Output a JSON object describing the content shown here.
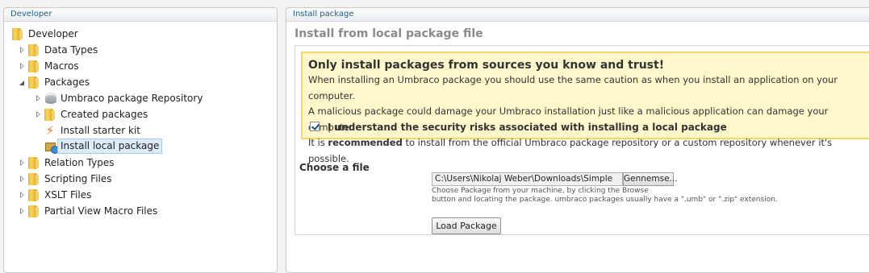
{
  "left_panel": {
    "header": "Developer",
    "tree": [
      {
        "label": "Developer",
        "icon": "folder-icon",
        "arrow": "none"
      },
      {
        "label": "Data Types",
        "icon": "folder-icon",
        "arrow": "collapsed"
      },
      {
        "label": "Macros",
        "icon": "folder-icon",
        "arrow": "collapsed"
      },
      {
        "label": "Packages",
        "icon": "folder-icon",
        "arrow": "expanded"
      },
      {
        "label": "Umbraco package Repository",
        "icon": "database-icon",
        "arrow": "collapsed"
      },
      {
        "label": "Created packages",
        "icon": "folder-icon",
        "arrow": "collapsed"
      },
      {
        "label": "Install starter kit",
        "icon": "lightning-icon",
        "arrow": "none"
      },
      {
        "label": "Install local package",
        "icon": "package-install-icon",
        "arrow": "none",
        "selected": true
      },
      {
        "label": "Relation Types",
        "icon": "folder-icon",
        "arrow": "collapsed"
      },
      {
        "label": "Scripting Files",
        "icon": "folder-icon",
        "arrow": "collapsed"
      },
      {
        "label": "XSLT Files",
        "icon": "folder-icon",
        "arrow": "collapsed"
      },
      {
        "label": "Partial View Macro Files",
        "icon": "folder-icon",
        "arrow": "collapsed"
      }
    ]
  },
  "right_panel": {
    "header": "Install package",
    "title": "Install from local package file",
    "warning": {
      "title": "Only install packages from sources you know and trust!",
      "line1": "When installing an Umbraco package you should use the same caution as when you install an application on your computer.",
      "line2": "A malicious package could damage your Umbraco installation just like a malicious application can damage your computer.",
      "line3_pre": "It is ",
      "line3_bold": "recommended",
      "line3_post": " to install from the official Umbraco package repository or a custom repository whenever it's possible.",
      "checkbox_label": "I understand the security risks associated with installing a local package",
      "checkbox_checked": true
    },
    "choose_file_label": "Choose a file",
    "file_value": "C:\\Users\\Nikolaj Weber\\Downloads\\Simple",
    "browse_label": "Gennemse...",
    "help_line1": "Choose Package from your machine, by clicking the Browse",
    "help_line2": "button and locating the package. umbraco packages usually have a \".umb\" or \".zip\" extension.",
    "load_button": "Load Package"
  },
  "colors": {
    "header_text": "#1d5e86",
    "warning_bg": "#fff7cc",
    "warning_border": "#f5d666",
    "selection_bg": "#dcebf7"
  }
}
